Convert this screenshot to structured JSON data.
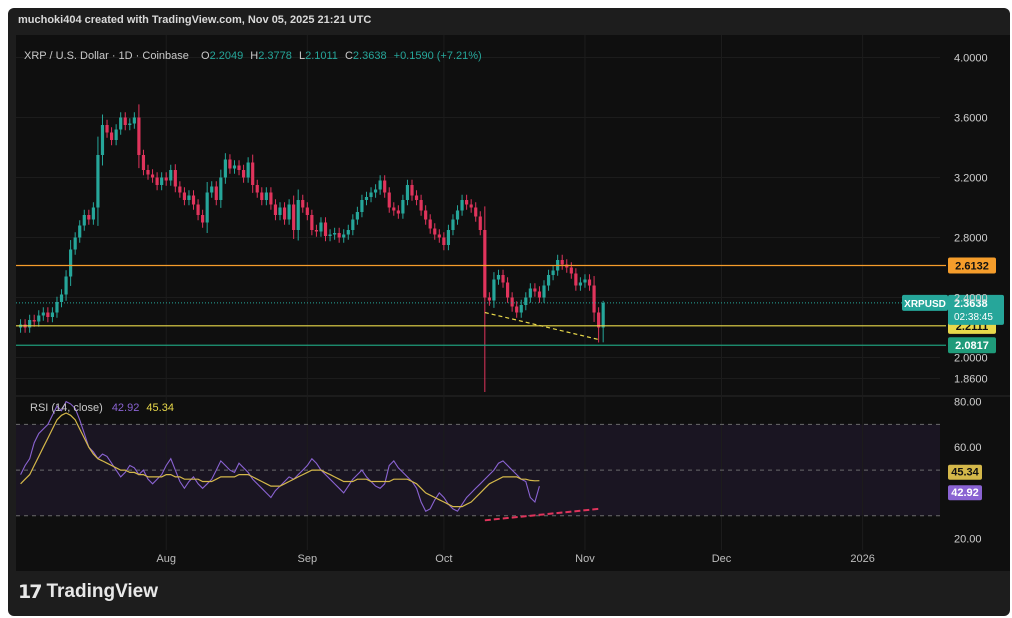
{
  "credit_line": "muchoki404 created with TradingView.com, Nov 05, 2025 21:21 UTC",
  "brand": {
    "name": "TradingView",
    "mark": "17"
  },
  "header": {
    "symbol": "XRP / U.S. Dollar · 1D · Coinbase",
    "open_label": "O",
    "open": "2.2049",
    "high_label": "H",
    "high": "2.3778",
    "low_label": "L",
    "low": "2.1011",
    "close_label": "C",
    "close": "2.3638",
    "change": "+0.1590 (+7.21%)"
  },
  "colors": {
    "background": "#0f0f0f",
    "up": "#26a69a",
    "down": "#e0345c",
    "rsi": "#8a63d2",
    "rsi_ma": "#d4b84a",
    "orange_line": "#f59d2b",
    "yellow_line": "#e8d84a",
    "green_line": "#1f9b7a",
    "divergence": "#e0345c"
  },
  "chart_data": [
    {
      "type": "candlestick",
      "title": "XRP / U.S. Dollar · 1D · Coinbase",
      "ylim": [
        1.75,
        4.15
      ],
      "y_ticks": [
        "4.0000",
        "3.6000",
        "3.2000",
        "2.8000",
        "2.4000",
        "2.0000",
        "1.8600"
      ],
      "y_tick_values": [
        4.0,
        3.6,
        3.2,
        2.8,
        2.4,
        2.0,
        1.86
      ],
      "x_ticks": [
        "Aug",
        "Sep",
        "Oct",
        "Nov",
        "Dec",
        "2026"
      ],
      "x_tick_dates": [
        "2025-08-01",
        "2025-09-01",
        "2025-10-01",
        "2025-11-01",
        "2025-12-01",
        "2026-01-01"
      ],
      "x_range": [
        "2025-06-29",
        "2026-01-18"
      ],
      "close_series": [
        [
          "2025-06-30",
          2.22
        ],
        [
          "2025-07-01",
          2.2
        ],
        [
          "2025-07-02",
          2.25
        ],
        [
          "2025-07-03",
          2.24
        ],
        [
          "2025-07-04",
          2.28
        ],
        [
          "2025-07-05",
          2.3
        ],
        [
          "2025-07-06",
          2.27
        ],
        [
          "2025-07-07",
          2.3
        ],
        [
          "2025-07-08",
          2.37
        ],
        [
          "2025-07-09",
          2.42
        ],
        [
          "2025-07-10",
          2.54
        ],
        [
          "2025-07-11",
          2.72
        ],
        [
          "2025-07-12",
          2.8
        ],
        [
          "2025-07-13",
          2.88
        ],
        [
          "2025-07-14",
          2.95
        ],
        [
          "2025-07-15",
          2.92
        ],
        [
          "2025-07-16",
          3.0
        ],
        [
          "2025-07-17",
          3.35
        ],
        [
          "2025-07-18",
          3.55
        ],
        [
          "2025-07-19",
          3.5
        ],
        [
          "2025-07-20",
          3.45
        ],
        [
          "2025-07-21",
          3.52
        ],
        [
          "2025-07-22",
          3.6
        ],
        [
          "2025-07-23",
          3.55
        ],
        [
          "2025-07-24",
          3.56
        ],
        [
          "2025-07-25",
          3.6
        ],
        [
          "2025-07-26",
          3.35
        ],
        [
          "2025-07-27",
          3.25
        ],
        [
          "2025-07-28",
          3.22
        ],
        [
          "2025-07-29",
          3.2
        ],
        [
          "2025-07-30",
          3.15
        ],
        [
          "2025-07-31",
          3.2
        ],
        [
          "2025-08-01",
          3.18
        ],
        [
          "2025-08-02",
          3.25
        ],
        [
          "2025-08-03",
          3.14
        ],
        [
          "2025-08-04",
          3.1
        ],
        [
          "2025-08-05",
          3.05
        ],
        [
          "2025-08-06",
          3.08
        ],
        [
          "2025-08-07",
          3.02
        ],
        [
          "2025-08-08",
          2.95
        ],
        [
          "2025-08-09",
          2.9
        ],
        [
          "2025-08-10",
          3.1
        ],
        [
          "2025-08-11",
          3.14
        ],
        [
          "2025-08-12",
          3.05
        ],
        [
          "2025-08-13",
          3.2
        ],
        [
          "2025-08-14",
          3.32
        ],
        [
          "2025-08-15",
          3.26
        ],
        [
          "2025-08-16",
          3.28
        ],
        [
          "2025-08-17",
          3.25
        ],
        [
          "2025-08-18",
          3.2
        ],
        [
          "2025-08-19",
          3.3
        ],
        [
          "2025-08-20",
          3.15
        ],
        [
          "2025-08-21",
          3.1
        ],
        [
          "2025-08-22",
          3.05
        ],
        [
          "2025-08-23",
          3.1
        ],
        [
          "2025-08-24",
          3.02
        ],
        [
          "2025-08-25",
          2.95
        ],
        [
          "2025-08-26",
          3.0
        ],
        [
          "2025-08-27",
          2.92
        ],
        [
          "2025-08-28",
          3.02
        ],
        [
          "2025-08-29",
          2.85
        ],
        [
          "2025-08-30",
          3.05
        ],
        [
          "2025-08-31",
          3.0
        ],
        [
          "2025-09-01",
          2.95
        ],
        [
          "2025-09-02",
          2.85
        ],
        [
          "2025-09-03",
          2.84
        ],
        [
          "2025-09-04",
          2.9
        ],
        [
          "2025-09-05",
          2.81
        ],
        [
          "2025-09-06",
          2.82
        ],
        [
          "2025-09-07",
          2.83
        ],
        [
          "2025-09-08",
          2.8
        ],
        [
          "2025-09-09",
          2.82
        ],
        [
          "2025-09-10",
          2.85
        ],
        [
          "2025-09-11",
          2.92
        ],
        [
          "2025-09-12",
          2.97
        ],
        [
          "2025-09-13",
          3.05
        ],
        [
          "2025-09-14",
          3.07
        ],
        [
          "2025-09-15",
          3.1
        ],
        [
          "2025-09-16",
          3.12
        ],
        [
          "2025-09-17",
          3.18
        ],
        [
          "2025-09-18",
          3.1
        ],
        [
          "2025-09-19",
          3.0
        ],
        [
          "2025-09-20",
          2.98
        ],
        [
          "2025-09-21",
          2.96
        ],
        [
          "2025-09-22",
          3.05
        ],
        [
          "2025-09-23",
          3.15
        ],
        [
          "2025-09-24",
          3.08
        ],
        [
          "2025-09-25",
          3.05
        ],
        [
          "2025-09-26",
          2.98
        ],
        [
          "2025-09-27",
          2.92
        ],
        [
          "2025-09-28",
          2.86
        ],
        [
          "2025-09-29",
          2.82
        ],
        [
          "2025-09-30",
          2.8
        ],
        [
          "2025-10-01",
          2.75
        ],
        [
          "2025-10-02",
          2.85
        ],
        [
          "2025-10-03",
          2.92
        ],
        [
          "2025-10-04",
          2.98
        ],
        [
          "2025-10-05",
          3.05
        ],
        [
          "2025-10-06",
          3.02
        ],
        [
          "2025-10-07",
          3.0
        ],
        [
          "2025-10-08",
          2.94
        ],
        [
          "2025-10-09",
          2.85
        ],
        [
          "2025-10-10",
          2.4
        ],
        [
          "2025-10-11",
          2.38
        ],
        [
          "2025-10-12",
          2.52
        ],
        [
          "2025-10-13",
          2.55
        ],
        [
          "2025-10-14",
          2.5
        ],
        [
          "2025-10-15",
          2.4
        ],
        [
          "2025-10-16",
          2.34
        ],
        [
          "2025-10-17",
          2.3
        ],
        [
          "2025-10-18",
          2.35
        ],
        [
          "2025-10-19",
          2.4
        ],
        [
          "2025-10-20",
          2.46
        ],
        [
          "2025-10-21",
          2.44
        ],
        [
          "2025-10-22",
          2.4
        ],
        [
          "2025-10-23",
          2.48
        ],
        [
          "2025-10-24",
          2.55
        ],
        [
          "2025-10-25",
          2.58
        ],
        [
          "2025-10-26",
          2.65
        ],
        [
          "2025-10-27",
          2.62
        ],
        [
          "2025-10-28",
          2.6
        ],
        [
          "2025-10-29",
          2.56
        ],
        [
          "2025-10-30",
          2.48
        ],
        [
          "2025-10-31",
          2.5
        ],
        [
          "2025-11-01",
          2.52
        ],
        [
          "2025-11-02",
          2.48
        ],
        [
          "2025-11-03",
          2.3
        ],
        [
          "2025-11-04",
          2.2
        ],
        [
          "2025-11-05",
          2.3638
        ]
      ],
      "horizontal_lines": [
        {
          "value": 2.6132,
          "label": "2.6132",
          "color": "#f59d2b"
        },
        {
          "value": 2.2111,
          "label": "2.2111",
          "color": "#e8d84a"
        },
        {
          "value": 2.0817,
          "label": "2.0817",
          "color": "#1f9b7a"
        }
      ],
      "current_price": {
        "ticker": "XRPUSD",
        "value": 2.3638,
        "label": "2.3638",
        "countdown": "02:38:45"
      },
      "trendline": {
        "from": [
          "2025-10-10",
          2.3
        ],
        "to": [
          "2025-11-04",
          2.12
        ],
        "style": "dashed",
        "color": "#e8d84a"
      }
    },
    {
      "type": "line",
      "title": "RSI (14, close)",
      "legend_values": [
        "42.92",
        "45.34"
      ],
      "ylim": [
        15,
        82
      ],
      "y_ticks": [
        "80.00",
        "60.00",
        "40.00",
        "20.00"
      ],
      "y_tick_values": [
        80,
        60,
        40,
        20
      ],
      "bands": [
        70,
        50,
        30
      ],
      "series": [
        {
          "name": "RSI",
          "last": 42.92,
          "color": "#8a63d2"
        },
        {
          "name": "RSI MA",
          "last": 45.34,
          "color": "#d4b84a"
        }
      ],
      "rsi_values": [
        48,
        52,
        55,
        62,
        66,
        68,
        70,
        74,
        78,
        76,
        80,
        79,
        77,
        72,
        66,
        60,
        58,
        55,
        57,
        56,
        53,
        50,
        47,
        49,
        52,
        51,
        48,
        50,
        46,
        44,
        46,
        48,
        52,
        55,
        50,
        45,
        42,
        45,
        47,
        44,
        42,
        44,
        46,
        50,
        54,
        52,
        50,
        49,
        53,
        51,
        49,
        46,
        44,
        42,
        40,
        38,
        41,
        43,
        45,
        47,
        46,
        48,
        50,
        52,
        55,
        53,
        50,
        48,
        46,
        44,
        42,
        40,
        43,
        46,
        48,
        50,
        47,
        45,
        43,
        42,
        44,
        52,
        54,
        51,
        49,
        47,
        45,
        42,
        36,
        32,
        33,
        37,
        40,
        38,
        35,
        33,
        32,
        35,
        38,
        40,
        42,
        44,
        46,
        48,
        50,
        53,
        54,
        52,
        50,
        48,
        46,
        45,
        38,
        36,
        42.92
      ],
      "rsi_ma_values": [
        44,
        46,
        48,
        52,
        56,
        60,
        64,
        68,
        72,
        74,
        75,
        74,
        72,
        68,
        64,
        60,
        57,
        55,
        54,
        53,
        52,
        51,
        50,
        50,
        49,
        49,
        48,
        48,
        47,
        47,
        47,
        47,
        48,
        48,
        47,
        47,
        46,
        46,
        46,
        46,
        45,
        45,
        45,
        46,
        47,
        47,
        47,
        47,
        48,
        48,
        48,
        47,
        46,
        45,
        44,
        43,
        43,
        43,
        44,
        45,
        46,
        47,
        48,
        49,
        50,
        50,
        50,
        49,
        48,
        47,
        46,
        45,
        45,
        45,
        46,
        46,
        46,
        45,
        45,
        45,
        45,
        45,
        46,
        46,
        46,
        46,
        45,
        44,
        42,
        40,
        39,
        38,
        37,
        36,
        35,
        34,
        34,
        34,
        35,
        36,
        38,
        40,
        42,
        44,
        45,
        46,
        47,
        47,
        47,
        47,
        46,
        46,
        45.5,
        45.3,
        45.34
      ],
      "divergence_line": {
        "from": [
          "2025-10-10",
          28
        ],
        "to": [
          "2025-11-04",
          33
        ],
        "style": "dashed",
        "color": "#e0345c"
      }
    }
  ]
}
